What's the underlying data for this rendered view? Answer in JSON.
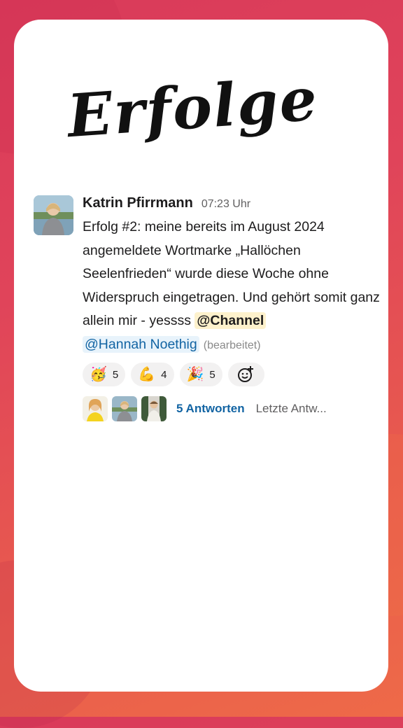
{
  "title": "Erfolge",
  "message": {
    "author": "Katrin Pfirrmann",
    "time": "07:23 Uhr",
    "text": "Erfolg #2: meine bereits im August 2024 angemeldete Wortmarke „Hallöchen Seelenfrieden“ wurde diese Woche ohne Widerspruch eingetragen. Und gehört somit ganz allein mir - yessss",
    "mention_channel": "@Channel",
    "mention_user": "@Hannah Noethig",
    "edited": "(bearbeitet)"
  },
  "reactions": [
    {
      "emoji": "🥳",
      "icon": "party-face-icon",
      "count": "5"
    },
    {
      "emoji": "💪",
      "icon": "flexed-biceps-icon",
      "count": "4"
    },
    {
      "emoji": "🎉",
      "icon": "party-popper-icon",
      "count": "5"
    }
  ],
  "thread": {
    "replies": "5 Antworten",
    "last_reply": "Letzte Antw..."
  },
  "colors": {
    "link": "#1264a3",
    "channel_mention_bg": "#fdf1cc",
    "user_mention_bg": "#e8f3fb",
    "reaction_bg": "#f2f1f1"
  }
}
